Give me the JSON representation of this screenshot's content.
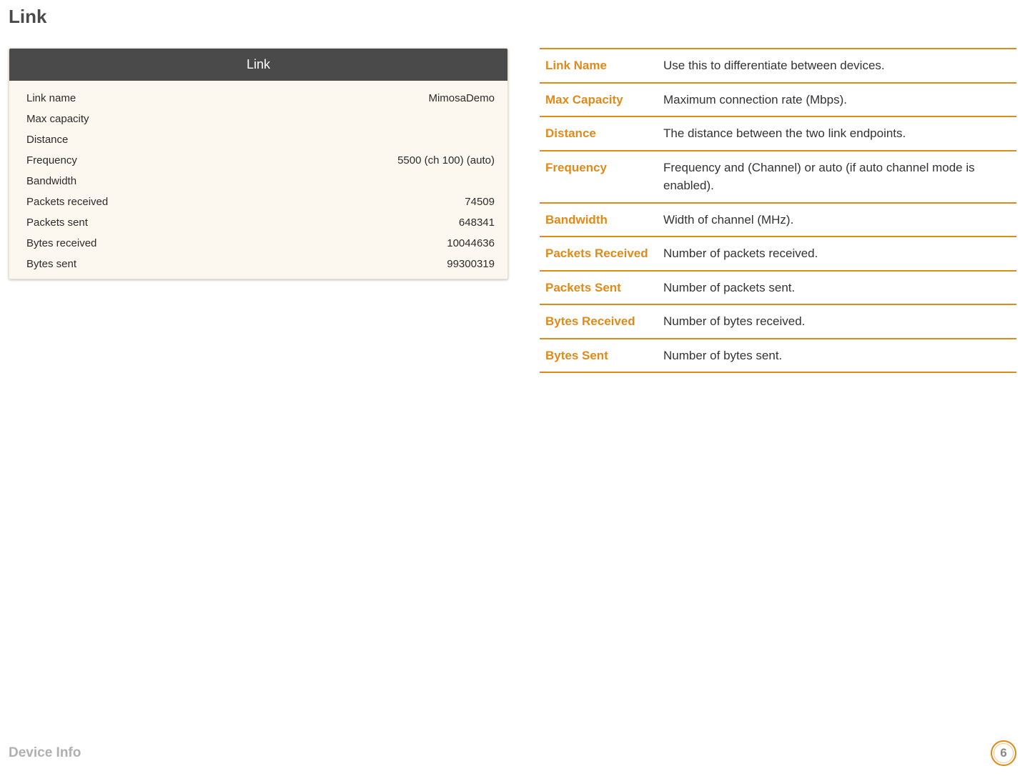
{
  "heading": "Link",
  "card": {
    "title": "Link",
    "rows": [
      {
        "label": "Link name",
        "value": "MimosaDemo"
      },
      {
        "label": "Max capacity",
        "value": ""
      },
      {
        "label": "Distance",
        "value": ""
      },
      {
        "label": "Frequency",
        "value": "5500 (ch 100) (auto)"
      },
      {
        "label": "Bandwidth",
        "value": ""
      },
      {
        "label": "Packets received",
        "value": "74509"
      },
      {
        "label": "Packets sent",
        "value": "648341"
      },
      {
        "label": "Bytes received",
        "value": "10044636"
      },
      {
        "label": "Bytes sent",
        "value": "99300319"
      }
    ]
  },
  "descriptions": [
    {
      "key": "Link Name",
      "val": "Use this to differentiate between devices."
    },
    {
      "key": "Max Capacity",
      "val": "Maximum connection rate (Mbps)."
    },
    {
      "key": "Distance",
      "val": "The distance between the two link endpoints."
    },
    {
      "key": "Frequency",
      "val": "Frequency and (Channel) or auto (if auto channel mode is enabled)."
    },
    {
      "key": "Bandwidth",
      "val": "Width of channel (MHz)."
    },
    {
      "key": "Packets Received",
      "val": "Number of packets received."
    },
    {
      "key": "Packets Sent",
      "val": "Number of packets sent."
    },
    {
      "key": "Bytes Received",
      "val": "Number of bytes received."
    },
    {
      "key": "Bytes Sent",
      "val": "Number of bytes sent."
    }
  ],
  "footer": {
    "section": "Device Info",
    "page": "6"
  }
}
